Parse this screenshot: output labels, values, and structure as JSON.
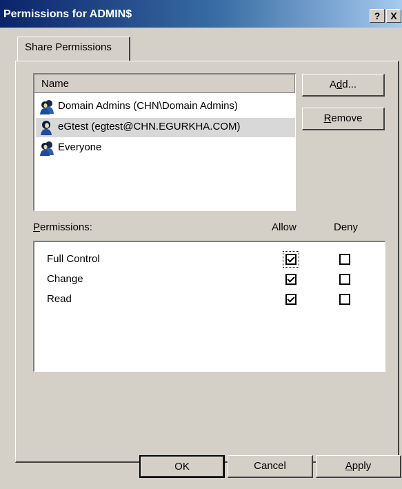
{
  "window": {
    "title": "Permissions for ADMIN$",
    "help_label": "?",
    "close_label": "X"
  },
  "tabs": [
    {
      "label": "Share Permissions",
      "active": true
    }
  ],
  "users": {
    "column_header": "Name",
    "items": [
      {
        "label": "Domain Admins (CHN\\Domain Admins)",
        "icon": "group-icon",
        "selected": false
      },
      {
        "label": "eGtest (egtest@CHN.EGURKHA.COM)",
        "icon": "user-icon",
        "selected": true
      },
      {
        "label": "Everyone",
        "icon": "group-icon",
        "selected": false
      }
    ]
  },
  "buttons": {
    "add": {
      "pre": "A",
      "accel": "d",
      "post": "d..."
    },
    "remove": {
      "pre": "",
      "accel": "R",
      "post": "emove"
    },
    "ok": "OK",
    "cancel": "Cancel",
    "apply": {
      "pre": "",
      "accel": "A",
      "post": "pply"
    }
  },
  "permissions": {
    "label": {
      "pre": "",
      "accel": "P",
      "post": "ermissions:"
    },
    "allow_header": "Allow",
    "deny_header": "Deny",
    "rows": [
      {
        "name": "Full Control",
        "allow": true,
        "deny": false
      },
      {
        "name": "Change",
        "allow": true,
        "deny": false
      },
      {
        "name": "Read",
        "allow": true,
        "deny": false
      }
    ]
  },
  "colors": {
    "titlebar_start": "#0a246a",
    "titlebar_end": "#a6caf0",
    "dialog_face": "#d4d0c8",
    "selection": "#d8d8d8"
  }
}
